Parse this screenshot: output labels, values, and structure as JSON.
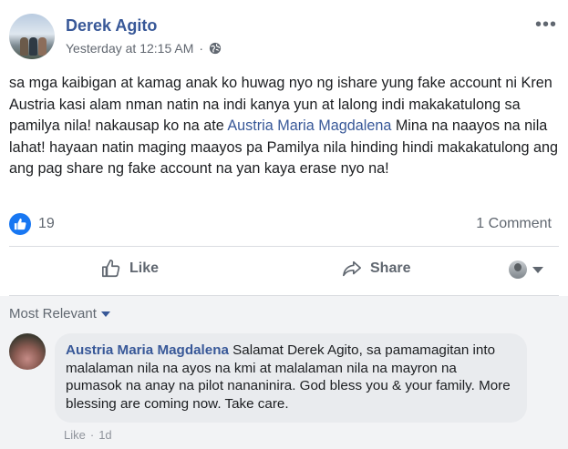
{
  "post": {
    "author": "Derek Agito",
    "timestamp": "Yesterday at 12:15 AM",
    "meta_separator": "·",
    "privacy_icon": "globe-icon",
    "more_icon": "•••",
    "text_part1": "sa mga kaibigan at kamag anak ko huwag nyo ng ishare yung fake account ni Kren Austria kasi alam nman natin na indi kanya yun at lalong indi makakatulong sa pamilya nila! nakausap ko na ate ",
    "mention": "Austria Maria Magdalena",
    "text_part2": " Mina na naayos na nila lahat! hayaan natin maging maayos pa Pamilya nila hinding hindi makakatulong ang ang pag share ng fake account na yan kaya erase nyo na!"
  },
  "reactions": {
    "count": "19",
    "icon": "like-icon",
    "comments_count": "1 Comment"
  },
  "actions": {
    "like_label": "Like",
    "share_label": "Share"
  },
  "comments_section": {
    "sort_label": "Most Relevant",
    "comment": {
      "author": "Austria Maria Magdalena",
      "text": " Salamat Derek Agito, sa pamamagitan into malalaman nila na ayos na kmi at malalaman nila na mayron na pumasok na anay na pilot nananinira. God bless you & your family. More blessing are coming now. Take care.",
      "like_label": "Like",
      "separator": "·",
      "age": "1d"
    }
  },
  "colors": {
    "link_blue": "#385898",
    "like_blue": "#1877f2",
    "muted_gray": "#606770",
    "comment_bubble": "#e9ebee"
  }
}
